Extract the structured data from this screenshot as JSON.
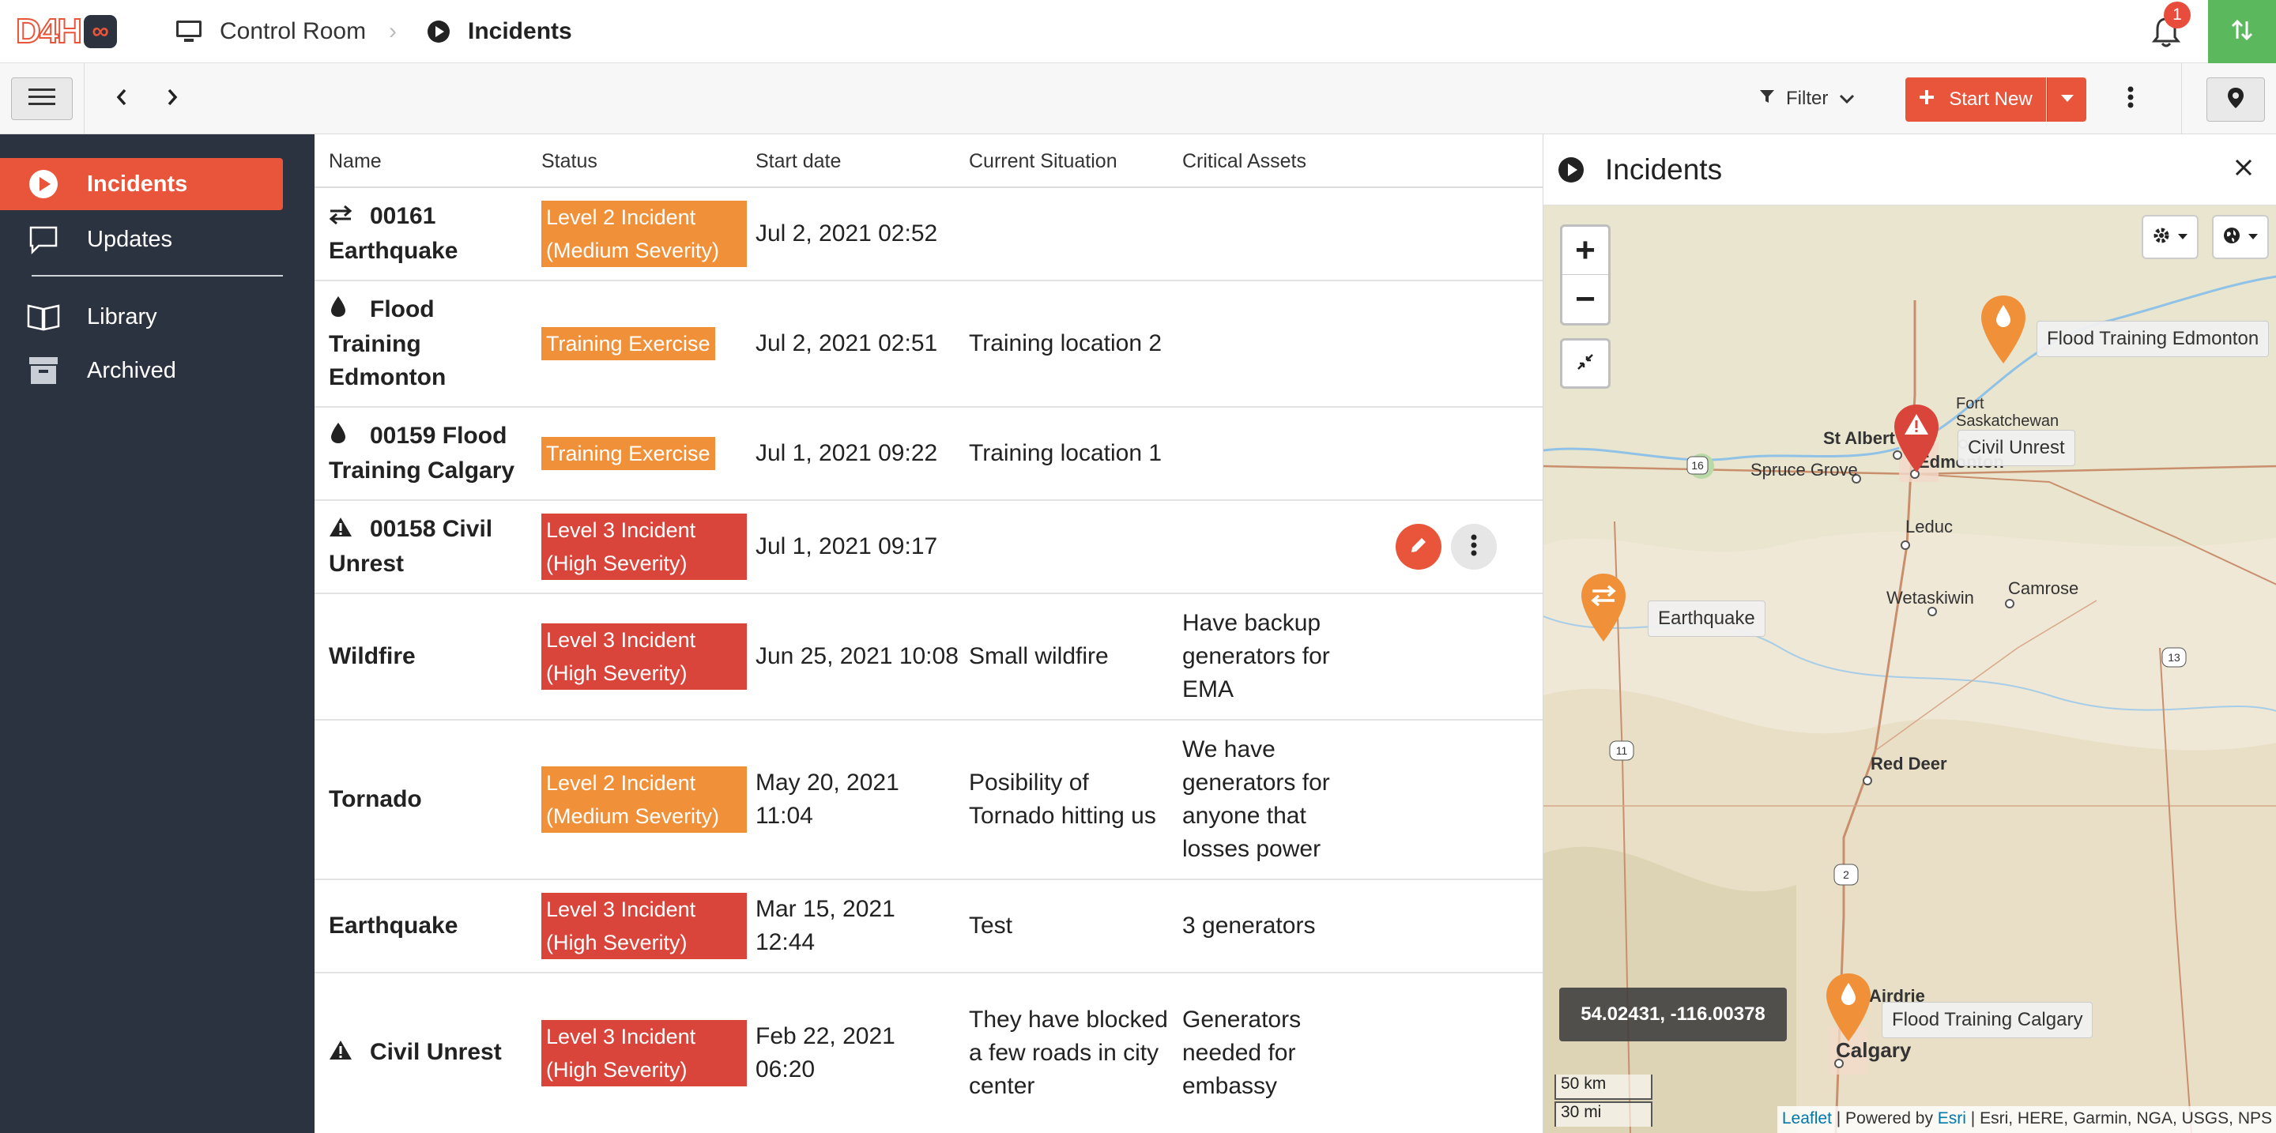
{
  "app": {
    "logo_text": "D4H",
    "logo_icon": "infinity-icon"
  },
  "breadcrumb": {
    "root": "Control Room",
    "separator": "›",
    "current": "Incidents"
  },
  "notifications": {
    "count": "1"
  },
  "toolbar": {
    "filter_label": "Filter",
    "start_new_label": "Start New"
  },
  "sidebar": {
    "items": [
      {
        "label": "Incidents",
        "icon": "play-circle-icon",
        "active": true
      },
      {
        "label": "Updates",
        "icon": "chat-bubble-icon"
      },
      {
        "label": "Library",
        "icon": "book-icon"
      },
      {
        "label": "Archived",
        "icon": "archive-box-icon"
      }
    ]
  },
  "table": {
    "headers": {
      "name": "Name",
      "status": "Status",
      "start_date": "Start date",
      "situation": "Current Situation",
      "assets": "Critical Assets"
    },
    "rows": [
      {
        "name": "00161 Earthquake",
        "icon": "exchange-arrows-icon",
        "status": "Level 2 Incident (Medium Severity)",
        "status_color": "#f0913a",
        "date": "Jul 2, 2021 02:52",
        "situation": "",
        "assets": ""
      },
      {
        "name": "Flood Training Edmonton",
        "icon": "water-drop-icon",
        "status": "Training Exercise",
        "status_color": "#f0913a",
        "date": "Jul 2, 2021 02:51",
        "situation": "Training location 2",
        "assets": ""
      },
      {
        "name": "00159 Flood Training Calgary",
        "icon": "water-drop-icon",
        "status": "Training Exercise",
        "status_color": "#f0913a",
        "date": "Jul 1, 2021 09:22",
        "situation": "Training location 1",
        "assets": ""
      },
      {
        "name": "00158 Civil Unrest",
        "icon": "warning-triangle-icon",
        "status": "Level 3 Incident (High Severity)",
        "status_color": "#d9453b",
        "date": "Jul 1, 2021 09:17",
        "situation": "",
        "assets": ""
      },
      {
        "name": "Wildfire",
        "icon": "",
        "status": "Level 3 Incident (High Severity)",
        "status_color": "#d9453b",
        "date": "Jun 25, 2021 10:08",
        "situation": "Small wildfire",
        "assets": "Have backup generators for EMA"
      },
      {
        "name": "Tornado",
        "icon": "",
        "status": "Level 2 Incident (Medium Severity)",
        "status_color": "#f0913a",
        "date": "May 20, 2021 11:04",
        "situation": "Posibility of Tornado hitting us",
        "assets": "We have generators for anyone that losses power"
      },
      {
        "name": "Earthquake",
        "icon": "",
        "status": "Level 3 Incident (High Severity)",
        "status_color": "#d9453b",
        "date": "Mar 15, 2021 12:44",
        "situation": "Test",
        "assets": "3 generators"
      },
      {
        "name": "Civil Unrest",
        "icon": "warning-triangle-icon",
        "status": "Level 3 Incident (High Severity)",
        "status_color": "#d9453b",
        "date": "Feb 22, 2021 06:20",
        "situation": "They have blocked a few roads in city center",
        "assets": "Generators needed for embassy"
      }
    ]
  },
  "panel": {
    "title": "Incidents",
    "map": {
      "markers": [
        {
          "label": "Flood Training Edmonton",
          "color": "#f0913a",
          "icon": "water-drop-icon"
        },
        {
          "label": "Civil Unrest",
          "color": "#d9453b",
          "icon": "warning-triangle-icon"
        },
        {
          "label": "Earthquake",
          "color": "#f0913a",
          "icon": "exchange-arrows-icon"
        },
        {
          "label": "Flood Training Calgary",
          "color": "#f0913a",
          "icon": "water-drop-icon"
        }
      ],
      "places": [
        "St Albert",
        "Fort Saskatchewan",
        "Spruce Grove",
        "Edmonton",
        "Leduc",
        "Wetaskiwin",
        "Camrose",
        "Red Deer",
        "Airdrie",
        "Calgary"
      ],
      "road_shields": [
        "16",
        "13",
        "11",
        "2"
      ],
      "coordinates": "54.02431, -116.00378",
      "scale_km": "50 km",
      "scale_mi": "30 mi",
      "attribution_leaflet": "Leaflet",
      "attribution_powered": " | Powered by ",
      "attribution_esri": "Esri",
      "attribution_rest": " | Esri, HERE, Garmin, NGA, USGS, NPS"
    }
  }
}
